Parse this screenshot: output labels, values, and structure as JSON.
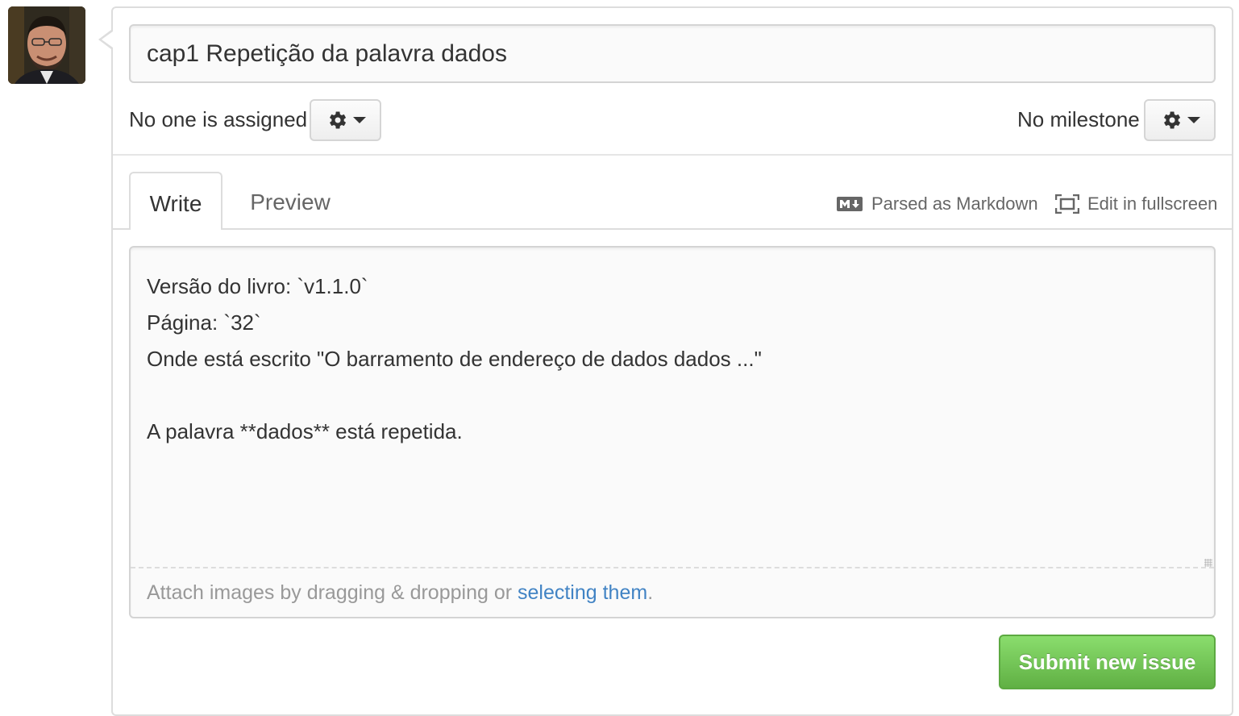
{
  "issue": {
    "title_value": "cap1 Repetição da palavra dados",
    "assignee_label": "No one is assigned",
    "milestone_label": "No milestone"
  },
  "tabs": {
    "write_label": "Write",
    "preview_label": "Preview"
  },
  "toolbar": {
    "markdown_label": "Parsed as Markdown",
    "fullscreen_label": "Edit in fullscreen",
    "markdown_icon": "markdown-icon",
    "fullscreen_icon": "fullscreen-icon"
  },
  "editor": {
    "body_value": "Versão do livro: `v1.1.0`\nPágina: `32`\nOnde está escrito \"O barramento de endereço de dados dados ...\"\n\nA palavra **dados** está repetida.",
    "attach_prefix": "Attach images by dragging & dropping or ",
    "attach_link": "selecting them",
    "attach_suffix": "."
  },
  "submit_label": "Submit new issue",
  "colors": {
    "accent_green": "#60b044",
    "link_blue": "#4183c4",
    "border": "#dddddd"
  }
}
